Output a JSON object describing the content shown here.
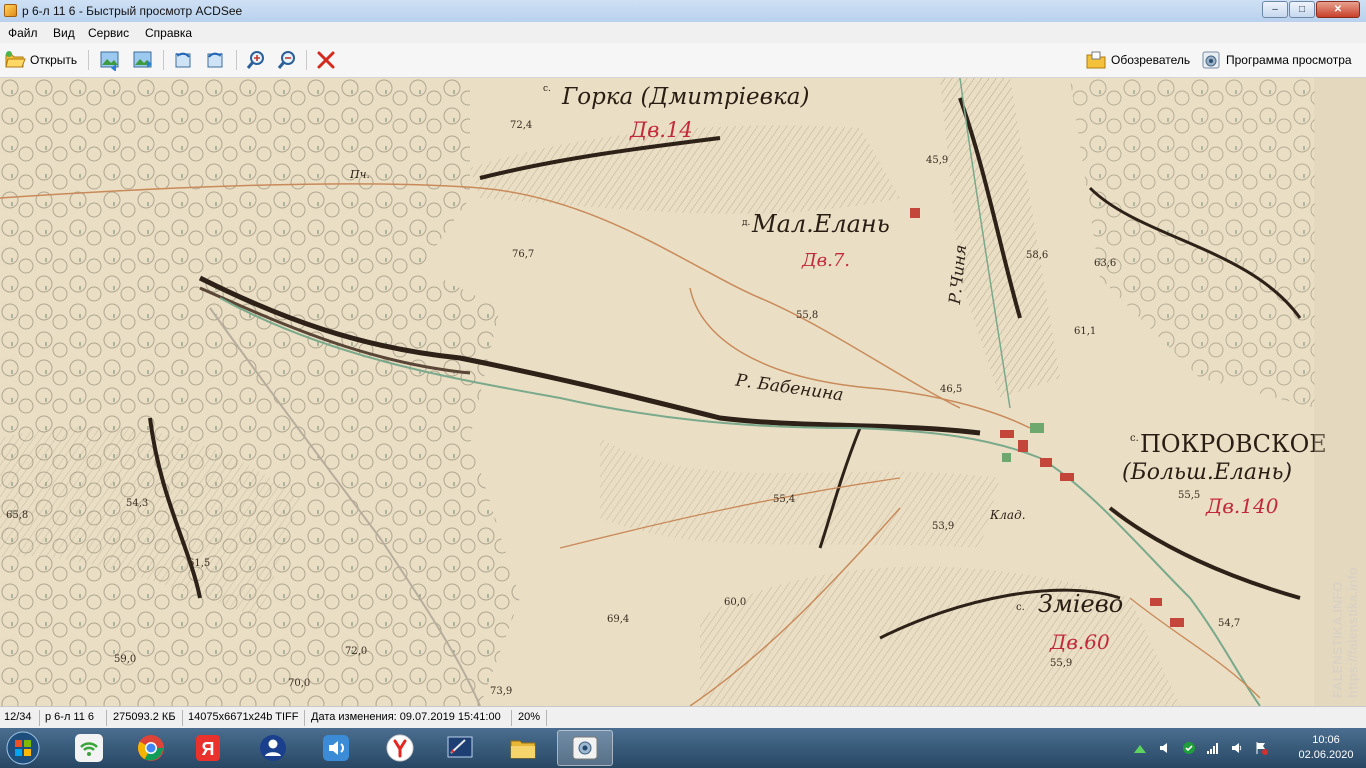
{
  "window": {
    "title": "р 6-л 11 6 - Быстрый просмотр ACDSee",
    "controls": {
      "minimize": "–",
      "maximize": "□",
      "close": "✕"
    }
  },
  "menu": {
    "items": [
      "Файл",
      "Вид",
      "Сервис",
      "Справка"
    ]
  },
  "toolbar": {
    "open_label": "Открыть",
    "buttons": [
      {
        "icon": "previous-image-icon"
      },
      {
        "icon": "next-image-icon"
      },
      {
        "icon": "rotate-left-icon"
      },
      {
        "icon": "rotate-right-icon"
      },
      {
        "icon": "zoom-in-icon"
      },
      {
        "icon": "zoom-out-icon"
      },
      {
        "icon": "delete-icon"
      }
    ],
    "browser_label": "Обозреватель",
    "viewer_label": "Программа просмотра"
  },
  "map": {
    "labels": {
      "gorka": "Горка (Дмитрiевка)",
      "gorka_prefix": "с.",
      "mal_elan": "Мал.Елань",
      "mal_elan_prefix": "д.",
      "pokrovskoe": "ПОКРОВСКОЕ",
      "pokrovskoe_prefix": "с.",
      "bolsh_elan": "(Больш.Елань)",
      "zmievo": "Змiево",
      "zmievo_prefix": "с.",
      "r_babenina": "Р. Бабенина",
      "r_chinya": "Р.Чиня",
      "klad": "Клад.",
      "pch": "Пч."
    },
    "households": {
      "gorka": "Дв.14",
      "mal_elan": "Дв.7.",
      "pokrovskoe": "Дв.140",
      "zmievo": "Дв.60"
    },
    "heights": [
      "72,4",
      "76,7",
      "55,8",
      "46,5",
      "58,6",
      "63,6",
      "61,1",
      "45,9",
      "54,3",
      "65,8",
      "61,5",
      "59,0",
      "72,0",
      "70,0",
      "73,9",
      "69,4",
      "60,0",
      "55,4",
      "53,9",
      "55,5",
      "54,7",
      "55,9"
    ],
    "watermark": "FALENSTIKA.INFO   https://falenstika.info"
  },
  "status": {
    "index": "12/34",
    "filename": "р 6-л 11 6",
    "size": "275093.2 КБ",
    "dimensions": "14075x6671x24b TIFF",
    "modified": "Дата изменения: 09.07.2019 15:41:00",
    "zoom": "20%"
  },
  "taskbar": {
    "apps": [
      "network-manager-icon",
      "chrome-icon",
      "yandex-icon",
      "user-icon",
      "audio-icon",
      "yandex-browser-icon",
      "image-editor-icon",
      "file-explorer-icon",
      "acdsee-icon"
    ],
    "tray": {
      "time": "10:06",
      "date": "02.06.2020"
    }
  },
  "colors": {
    "map_paper": "#e9dcc0",
    "map_red_text": "#c22a3c",
    "road": "#c98a5a",
    "hatching": "#3b2b1f",
    "taskbar": "#2f5373"
  }
}
